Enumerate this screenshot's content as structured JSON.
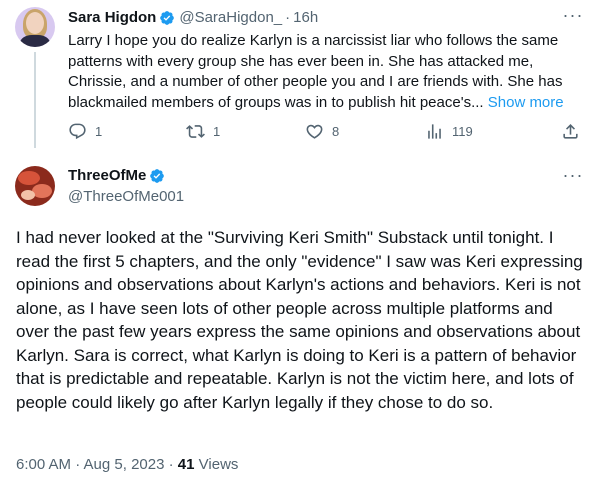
{
  "reply": {
    "author_name": "Sara Higdon",
    "author_handle": "@SaraHigdon_",
    "time": "16h",
    "text": "Larry I hope you do realize Karlyn is a narcissist liar who follows the same patterns with every group she has ever been in. She has attacked me, Chrissie, and a number of other people you and I are friends with. She has blackmailed members of groups was in to publish hit peace's...",
    "show_more": "Show more",
    "replies": "1",
    "reposts": "1",
    "likes": "8",
    "views": "119"
  },
  "main": {
    "author_name": "ThreeOfMe",
    "author_handle": "@ThreeOfMe001",
    "text": "I had never looked at the \"Surviving Keri Smith\" Substack until tonight. I read the first 5 chapters, and the only \"evidence\" I saw was Keri expressing opinions and observations about Karlyn's actions and behaviors. Keri is not alone, as I have seen lots of other people across multiple platforms and over the past few years express the same opinions and observations about Karlyn. Sara is correct, what Karlyn is doing to Keri is a pattern of behavior that is predictable and repeatable. Karlyn is not the victim here, and lots of people could likely go after Karlyn legally if they chose to do so.",
    "timestamp": "6:00 AM · Aug 5, 2023",
    "separator": "·",
    "view_count": "41",
    "views_label": "Views"
  },
  "colors": {
    "accent": "#1d9bf0",
    "text_primary": "#0f1419",
    "text_secondary": "#536471"
  },
  "icons": {
    "verified": "verified-badge-icon",
    "more": "more-horizontal-icon",
    "reply": "reply-bubble-icon",
    "repost": "repost-arrows-icon",
    "like": "heart-icon",
    "views": "bar-chart-icon",
    "share": "share-icon"
  }
}
